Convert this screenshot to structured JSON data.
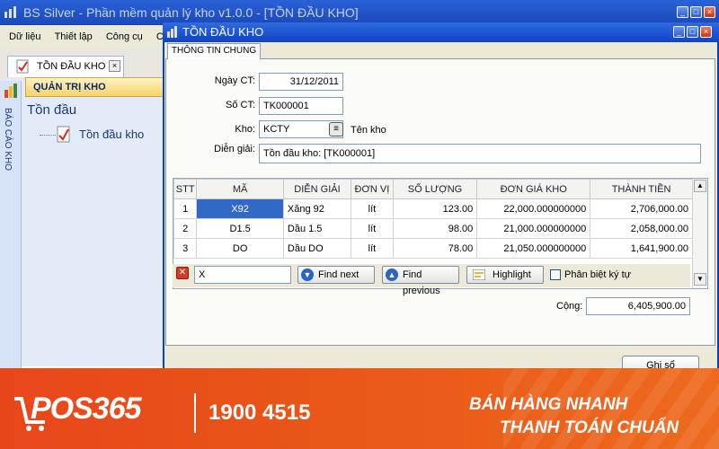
{
  "window": {
    "title": "BS Silver - Phần mềm quản lý kho v1.0.0 - [TỒN ĐẦU KHO]"
  },
  "menu": [
    "Dữ liệu",
    "Thiết lập",
    "Công cụ",
    "Cửa sổ"
  ],
  "doc_tab": {
    "label": "TỒN ĐẦU KHO"
  },
  "sidebar": {
    "vertical_label": "BÁO CÁO KHO",
    "header": "QUẢN TRỊ KHO",
    "title": "Tồn đầu",
    "tree_item": "Tồn đầu kho"
  },
  "dialog": {
    "title": "TỒN ĐẦU KHO",
    "tab": "THÔNG TIN CHUNG",
    "fields": {
      "date_label": "Ngày CT:",
      "date_value": "31/12/2011",
      "doc_no_label": "Số CT:",
      "doc_no_value": "TK000001",
      "warehouse_label": "Kho:",
      "warehouse_value": "KCTY",
      "warehouse_name_label": "Tên kho",
      "desc_label": "Diễn giải:",
      "desc_value": "Tồn đầu kho: [TK000001]"
    },
    "grid": {
      "headers": [
        "STT",
        "MÃ",
        "DIỄN GIẢI",
        "ĐƠN VỊ",
        "SỐ LƯỢNG",
        "ĐƠN GIÁ KHO",
        "THÀNH TIỀN"
      ],
      "rows": [
        [
          "1",
          "X92",
          "Xăng 92",
          "lít",
          "123.00",
          "22,000.000000000",
          "2,706,000.00"
        ],
        [
          "2",
          "D1.5",
          "Dầu 1.5",
          "lít",
          "98.00",
          "21,000.000000000",
          "2,058,000.00"
        ],
        [
          "3",
          "DO",
          "Dầu DO",
          "lít",
          "78.00",
          "21,050.000000000",
          "1,641,900.00"
        ]
      ]
    },
    "find": {
      "input_value": "X",
      "find_next": "Find next",
      "find_previous": "Find previous",
      "highlight": "Highlight",
      "case_sensitive": "Phân biệt ký tự"
    },
    "total_label": "Cộng:",
    "total_value": "6,405,900.00",
    "save_button": "Ghi sổ"
  },
  "banner": {
    "logo": "POS365",
    "hotline": "1900 4515",
    "slogan_line1": "BÁN HÀNG NHANH",
    "slogan_line2": "THANH TOÁN CHUẨN"
  }
}
